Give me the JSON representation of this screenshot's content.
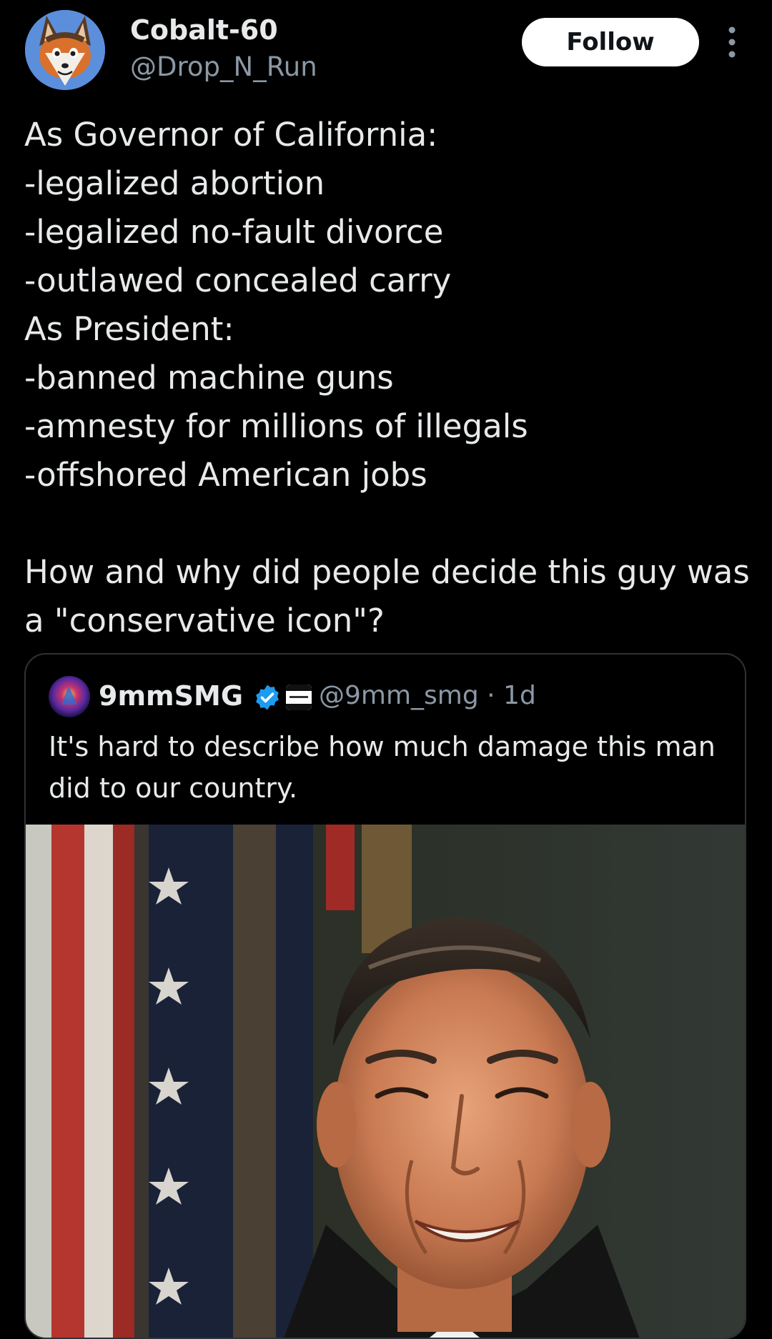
{
  "tweet": {
    "display_name": "Cobalt-60",
    "handle": "@Drop_N_Run",
    "follow_label": "Follow",
    "text": "As Governor of California:\n-legalized abortion\n-legalized no-fault divorce\n-outlawed concealed carry\nAs President:\n-banned machine guns\n-amnesty for millions of illegals\n-offshored American jobs\n\nHow and why did people decide this guy was a \"conservative icon\"?"
  },
  "quoted_tweet": {
    "display_name": "9mmSMG",
    "handle_time": "@9mm_smg · 1d",
    "text": "It's hard to describe how much damage this man did to our country.",
    "verified": true
  },
  "colors": {
    "background": "#000000",
    "text_primary": "#e7e9ea",
    "text_secondary": "#8b98a5",
    "border": "#2f3336",
    "verified_blue": "#1d9bf0"
  }
}
